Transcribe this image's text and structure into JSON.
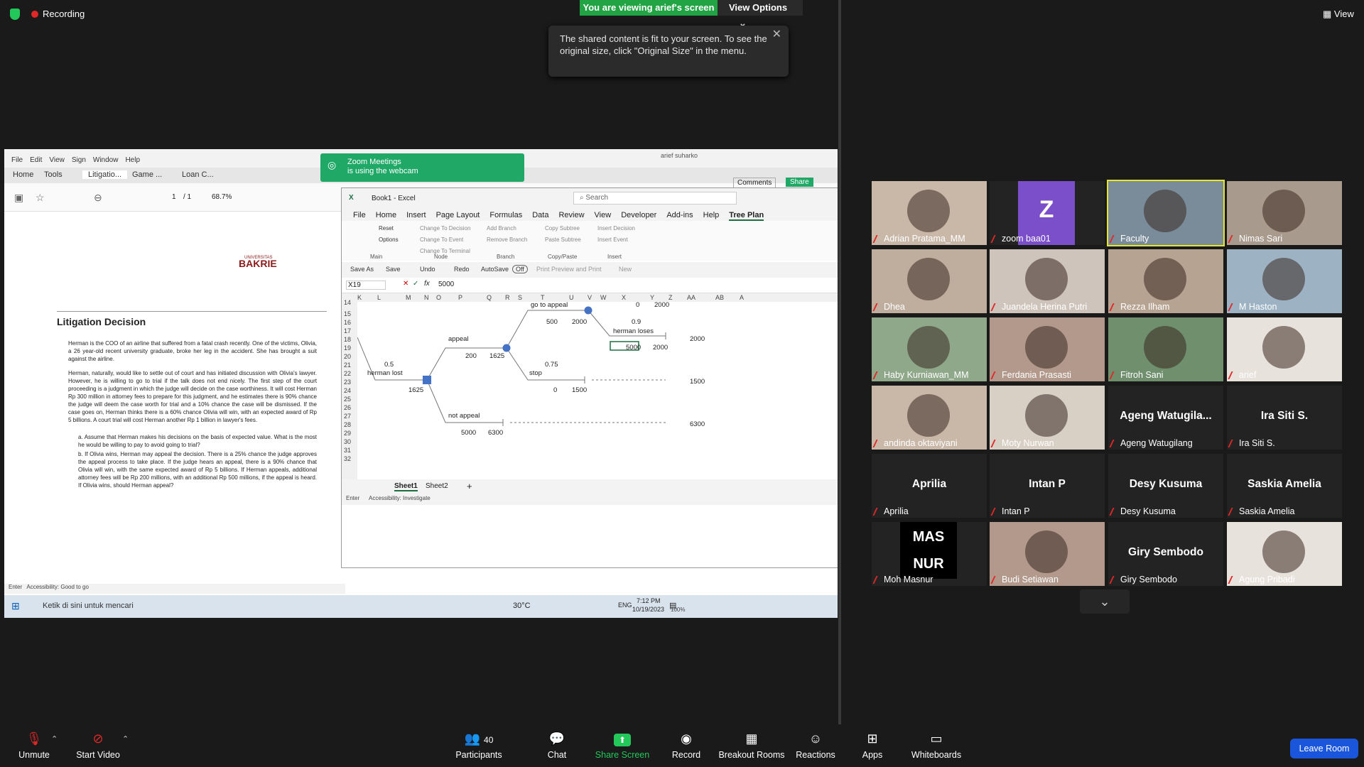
{
  "topbar": {
    "recording": "Recording",
    "viewing": "You are viewing arief's screen",
    "view_options": "View Options",
    "tooltip": "The shared content is fit to your screen. To see the original size, click \"Original Size\" in the menu.",
    "view": "View"
  },
  "pdf": {
    "menu": [
      "File",
      "Edit",
      "View",
      "Sign",
      "Window",
      "Help"
    ],
    "tabs": [
      "Home",
      "Tools",
      "Litigatio...",
      "Game ...",
      "Loan C..."
    ],
    "page": "1",
    "pages": "/ 1",
    "zoom": "68.7%",
    "logo_top": "UNIVERSITAS",
    "logo": "BAKRIE",
    "title": "Litigation Decision",
    "p1": "Herman is the COO of an airline that suffered from a fatal crash recently. One of the victims, Olivia, a 26 year-old recent university graduate, broke her leg in the accident. She has brought a suit against the airline.",
    "p2": "Herman, naturally, would like to settle out of court and has initiated discussion with Olivia's lawyer. However, he is willing to go to trial if the talk does not end nicely. The first step of the court proceeding is a judgment in which the judge will decide on the case worthiness. It will cost Herman Rp 300 million in attorney fees to prepare for this judgment, and he estimates there is 90% chance the judge will deem the case worth for trial and a 10% chance the case will be dismissed. If the case goes on, Herman thinks there is a 60% chance Olivia will win, with an expected award of Rp 5 billions. A court trial will cost Herman another Rp 1 billion in lawyer's fees.",
    "qa": "a. Assume that Herman makes his decisions on the basis of expected value. What is the most he would be willing to pay to avoid going to trial?",
    "qb": "b. If Olivia wins, Herman may appeal the decision. There is a 25% chance the judge approves the appeal process to take place. If the judge hears an appeal, there is a 90% chance that Olivia will win, with the same expected award of Rp 5 billions. If Herman appeals, additional attorney fees will be Rp 200 millions, with an additional Rp 500 millions, if the appeal is heard. If Olivia wins, should Herman appeal?",
    "status": "Accessibility: Good to go",
    "enter": "Enter",
    "comments": "Comments",
    "share": "Share",
    "user": "arief suharko"
  },
  "zoom_webcam": {
    "line1": "Zoom Meetings",
    "line2": "is using the webcam"
  },
  "excel": {
    "title": "Book1 - Excel",
    "search": "Search",
    "tabs": [
      "File",
      "Home",
      "Insert",
      "Page Layout",
      "Formulas",
      "Data",
      "Review",
      "View",
      "Developer",
      "Add-ins",
      "Help",
      "Tree Plan"
    ],
    "ribbon": [
      "Reset",
      "Options",
      "Change To Decision",
      "Change To Event",
      "Change To Terminal",
      "Add Branch",
      "Remove Branch",
      "Copy Subtree",
      "Paste Subtree",
      "Insert Decision",
      "Insert Event"
    ],
    "groups": [
      "Main",
      "Node",
      "Branch",
      "Copy/Paste",
      "Insert"
    ],
    "qat": [
      "Save As",
      "Save",
      "Undo",
      "Redo",
      "AutoSave",
      "Off",
      "Print Preview and Print",
      "New"
    ],
    "namebox": "X19",
    "formula": "5000",
    "cols": [
      "K",
      "L",
      "M",
      "N",
      "O",
      "P",
      "Q",
      "R",
      "S",
      "T",
      "U",
      "V",
      "W",
      "X",
      "Y",
      "Z",
      "AA",
      "AB",
      "A"
    ],
    "rows": [
      "14",
      "15",
      "16",
      "17",
      "18",
      "19",
      "20",
      "21",
      "22",
      "23",
      "24",
      "25",
      "26",
      "27",
      "28",
      "29",
      "30",
      "31",
      "32"
    ],
    "cells": {
      "go_to_appeal": "go to appeal",
      "v0a": "0",
      "v2000a": "2000",
      "v09": "0.9",
      "v500": "500",
      "v2000b": "2000",
      "herman_loses": "herman loses",
      "appeal": "appeal",
      "v2000c": "2000",
      "v200": "200",
      "v1625a": "1625",
      "v5000": "5000",
      "v2000d": "2000",
      "v05": "0.5",
      "v075": "0.75",
      "herman_lost": "herman lost",
      "stop": "stop",
      "v1500a": "1500",
      "v1625b": "1625",
      "v0b": "0",
      "v1500b": "1500",
      "not_appeal": "not appeal",
      "v6300a": "6300",
      "v5000b": "5000",
      "v6300b": "6300"
    },
    "sheets": [
      "Sheet1",
      "Sheet2"
    ],
    "status": "Enter",
    "access": "Accessibility: Investigate"
  },
  "taskbar": {
    "search": "Ketik di sini untuk mencari",
    "temp": "30°C",
    "lang": "ENG",
    "time": "7:12 PM",
    "date": "10/19/2023",
    "zoom": "100%"
  },
  "participants": [
    {
      "name": "Adrian Pratama_MM"
    },
    {
      "name": "zoom baa01",
      "initial": "Z"
    },
    {
      "name": "Faculty"
    },
    {
      "name": "Nimas Sari"
    },
    {
      "name": "Dhea"
    },
    {
      "name": "Juandela Herina Putri"
    },
    {
      "name": "Rezza Ilham"
    },
    {
      "name": "M Haston"
    },
    {
      "name": "Haby Kurniawan_MM"
    },
    {
      "name": "Ferdania Prasasti"
    },
    {
      "name": "Fitroh Sani"
    },
    {
      "name": "arief"
    },
    {
      "name": "andinda oktaviyani"
    },
    {
      "name": "Moty Nurwan"
    },
    {
      "name": "Ageng Watugilang",
      "big": "Ageng  Watugila..."
    },
    {
      "name": "Ira Siti S.",
      "big": "Ira Siti S."
    },
    {
      "name": "Aprilia",
      "big": "Aprilia"
    },
    {
      "name": "Intan P",
      "big": "Intan P"
    },
    {
      "name": "Desy Kusuma",
      "big": "Desy Kusuma"
    },
    {
      "name": "Saskia Amelia",
      "big": "Saskia Amelia"
    },
    {
      "name": "Moh Masnur",
      "logo": "MAS NUR"
    },
    {
      "name": "Budi Setiawan"
    },
    {
      "name": "Giry Sembodo",
      "big": "Giry Sembodo"
    },
    {
      "name": "Agung Pribadi"
    }
  ],
  "bottom": {
    "unmute": "Unmute",
    "start_video": "Start Video",
    "participants": "Participants",
    "count": "40",
    "chat": "Chat",
    "share": "Share Screen",
    "record": "Record",
    "breakout": "Breakout Rooms",
    "reactions": "Reactions",
    "apps": "Apps",
    "whiteboards": "Whiteboards",
    "leave": "Leave Room"
  },
  "colors": {
    "green": "#22a344",
    "leave": "#1a56db",
    "zoomgreen": "#23c85a",
    "mute_red": "#e02828"
  }
}
